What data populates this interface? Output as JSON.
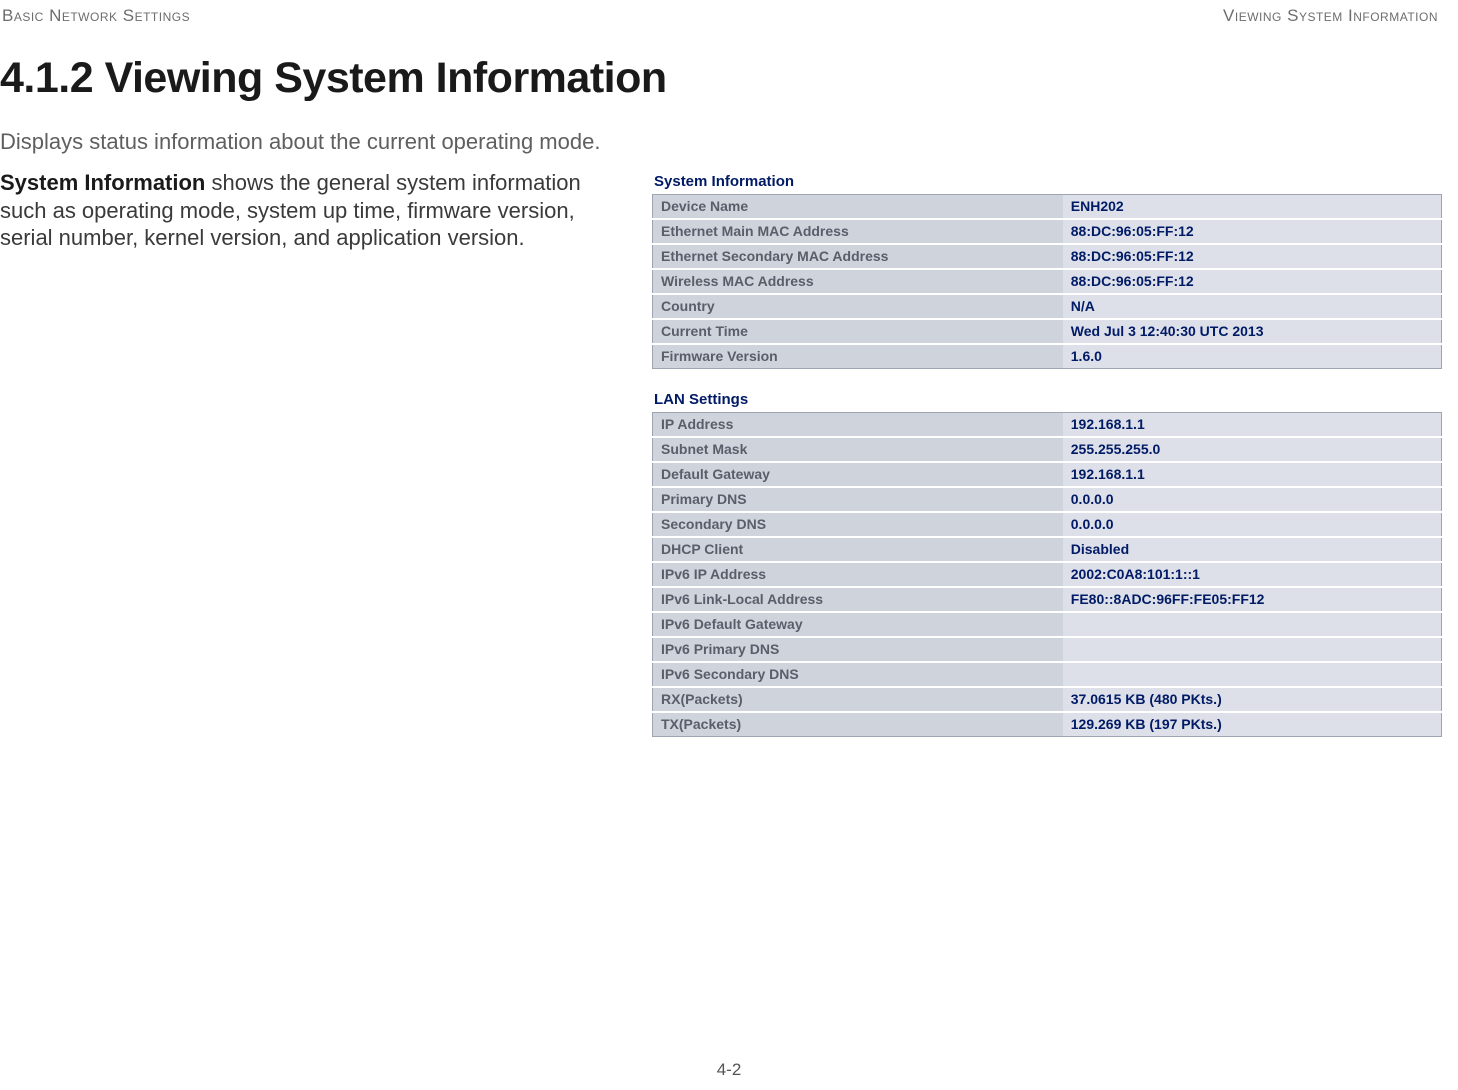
{
  "header": {
    "left": "Basic Network Settings",
    "right": "Viewing System Information"
  },
  "title": "4.1.2 Viewing System Information",
  "lead": "Displays status information about the current operating mode.",
  "paragraph": {
    "bold": "System Information",
    "rest": "  shows the general system information such as operating mode, system up time, firmware version, serial number, kernel version, and application version."
  },
  "sections": [
    {
      "title": "System Information",
      "rows": [
        {
          "key": "Device Name",
          "val": "ENH202"
        },
        {
          "key": "Ethernet Main MAC Address",
          "val": "88:DC:96:05:FF:12"
        },
        {
          "key": "Ethernet Secondary MAC Address",
          "val": "88:DC:96:05:FF:12"
        },
        {
          "key": "Wireless MAC Address",
          "val": "88:DC:96:05:FF:12"
        },
        {
          "key": "Country",
          "val": "N/A"
        },
        {
          "key": "Current Time",
          "val": "Wed Jul 3 12:40:30 UTC 2013"
        },
        {
          "key": "Firmware Version",
          "val": "1.6.0"
        }
      ]
    },
    {
      "title": "LAN Settings",
      "rows": [
        {
          "key": "IP Address",
          "val": "192.168.1.1"
        },
        {
          "key": "Subnet Mask",
          "val": "255.255.255.0"
        },
        {
          "key": "Default Gateway",
          "val": "192.168.1.1"
        },
        {
          "key": "Primary DNS",
          "val": "0.0.0.0"
        },
        {
          "key": "Secondary DNS",
          "val": "0.0.0.0"
        },
        {
          "key": "DHCP Client",
          "val": "Disabled"
        },
        {
          "key": "IPv6 IP Address",
          "val": "2002:C0A8:101:1::1"
        },
        {
          "key": "IPv6 Link-Local Address",
          "val": "FE80::8ADC:96FF:FE05:FF12"
        },
        {
          "key": "IPv6 Default Gateway",
          "val": ""
        },
        {
          "key": "IPv6 Primary DNS",
          "val": ""
        },
        {
          "key": "IPv6 Secondary DNS",
          "val": ""
        },
        {
          "key": "RX(Packets)",
          "val": "37.0615 KB (480 PKts.)"
        },
        {
          "key": "TX(Packets)",
          "val": "129.269 KB (197 PKts.)"
        }
      ]
    }
  ],
  "page_number": "4-2"
}
